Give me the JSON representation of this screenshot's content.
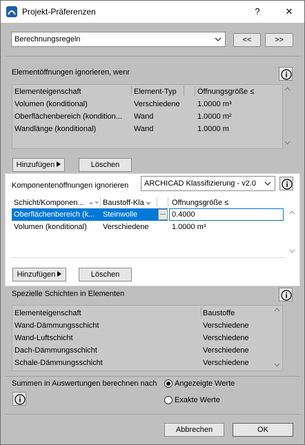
{
  "window": {
    "title": "Projekt-Präferenzen",
    "help_glyph": "?",
    "close_glyph": "✕",
    "icon": "archicad-app-icon"
  },
  "topbar": {
    "preset_value": "Berechnungsregeln",
    "prev_label": "<<",
    "next_label": ">>"
  },
  "element_openings": {
    "heading": "Elementöffnungen ignorieren, wenr",
    "columns": [
      "Elementeigenschaft",
      "Element-Typ",
      "Öffnungsgröße ≤"
    ],
    "rows": [
      [
        "Volumen (konditional)",
        "Verschiedene",
        "1.0000 m³"
      ],
      [
        "Oberflächenbereich (kondition...",
        "Wand",
        "1.0000 m²"
      ],
      [
        "Wandlänge (konditional)",
        "Wand",
        "1.0000 m"
      ]
    ],
    "add_label": "Hinzufügen",
    "delete_label": "Löschen"
  },
  "component_openings": {
    "heading": "Komponentenöffnungen ignorieren",
    "classification_value": "ARCHICAD Klassifizierung - v2.0",
    "columns": [
      "Schicht/Komponen...",
      "Baustoff-Kla",
      "Öffnungsgröße ≤"
    ],
    "rows": [
      [
        "Oberflächenbereich (k...",
        "Steinwolle",
        "0.4000"
      ],
      [
        "Volumen (konditional)",
        "Verschiedene",
        "1.0000 m³"
      ]
    ],
    "browse_label": "...",
    "add_label": "Hinzufügen",
    "delete_label": "Löschen"
  },
  "special_layers": {
    "heading": "Spezielle Schichten in Elementen",
    "columns": [
      "Elementeigenschaft",
      "Baustoffe"
    ],
    "rows": [
      [
        "Wand-Dämmungsschicht",
        "Verschiedene"
      ],
      [
        "Wand-Luftschicht",
        "Verschiedene"
      ],
      [
        "Dach-Dämmungsschicht",
        "Verschiedene"
      ],
      [
        "Schale-Dämmungsschicht",
        "Verschiedene"
      ]
    ]
  },
  "sums": {
    "label": "Summen in Auswertungen berechnen nach",
    "option_displayed": "Angezeigte Werte",
    "option_exact": "Exakte Werte",
    "selected": "Angezeigte Werte"
  },
  "footer": {
    "cancel_label": "Abbrechen",
    "ok_label": "OK"
  }
}
